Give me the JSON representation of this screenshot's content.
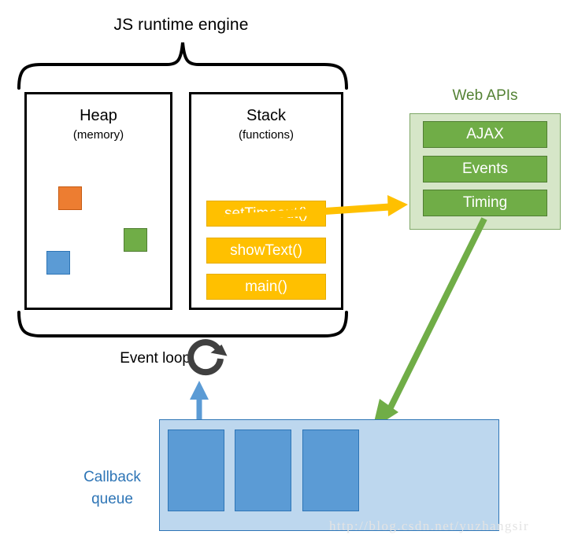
{
  "diagram": {
    "runtime_title": "JS runtime engine",
    "heap": {
      "title": "Heap",
      "subtitle": "(memory)",
      "blocks": [
        {
          "name": "orange-block",
          "color": "#ED7D31"
        },
        {
          "name": "green-block",
          "color": "#70AD47"
        },
        {
          "name": "blue-block",
          "color": "#5B9BD5"
        }
      ]
    },
    "stack": {
      "title": "Stack",
      "subtitle": "(functions)",
      "frames": [
        {
          "label": "setTimeout()"
        },
        {
          "label": "showText()"
        },
        {
          "label": "main()"
        }
      ],
      "frame_color": "#FFC000"
    },
    "web_apis": {
      "title": "Web APIs",
      "title_color": "#548235",
      "box_color": "#D6E6C8",
      "item_color": "#70AD47",
      "items": [
        {
          "label": "AJAX"
        },
        {
          "label": "Events"
        },
        {
          "label": "Timing"
        }
      ]
    },
    "event_loop": {
      "label": "Event loop",
      "icon": "circular-refresh-arrow-icon",
      "icon_color": "#404040"
    },
    "callback_queue": {
      "label_line1": "Callback",
      "label_line2": "queue",
      "label_color": "#2E75B6",
      "box_color": "#BDD7EE",
      "item_color": "#5B9BD5",
      "items": [
        {
          "name": "callback-item-1"
        },
        {
          "name": "callback-item-2"
        },
        {
          "name": "callback-item-3"
        }
      ]
    },
    "arrows": [
      {
        "name": "stack-to-timing-arrow",
        "color": "#FFC000",
        "from": "setTimeout()",
        "to": "Timing"
      },
      {
        "name": "timing-to-callback-queue-arrow",
        "color": "#70AD47",
        "from": "Timing",
        "to": "Callback queue"
      },
      {
        "name": "callback-queue-to-event-loop-arrow",
        "color": "#5B9BD5",
        "from": "Callback queue",
        "to": "Event loop"
      }
    ],
    "watermark": "http://blog.csdn.net/yuzhangsir"
  }
}
